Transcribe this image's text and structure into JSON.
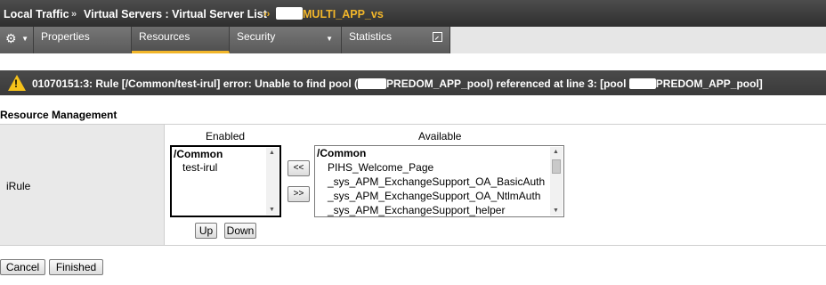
{
  "breadcrumb": {
    "items": [
      "Local Traffic",
      "Virtual Servers : Virtual Server List"
    ],
    "separator": "»",
    "current_separator": "››",
    "current": "MULTI_APP_vs"
  },
  "tabs": [
    {
      "label": "Properties"
    },
    {
      "label": "Resources"
    },
    {
      "label": "Security"
    },
    {
      "label": "Statistics"
    }
  ],
  "active_tab": "Resources",
  "error": {
    "text_part1": "01070151:3: Rule [/Common/test-irul] error: Unable to find pool (",
    "text_part2": "PREDOM_APP_pool) referenced at line 3: [pool",
    "text_part3": "PREDOM_APP_pool]"
  },
  "section_title": "Resource Management",
  "irule": {
    "label": "iRule",
    "enabled_heading": "Enabled",
    "available_heading": "Available",
    "enabled_group": "/Common",
    "enabled_items": [
      "test-irul"
    ],
    "available_group": "/Common",
    "available_items": [
      "PIHS_Welcome_Page",
      "_sys_APM_ExchangeSupport_OA_BasicAuth",
      "_sys_APM_ExchangeSupport_OA_NtlmAuth",
      "_sys_APM_ExchangeSupport_helper"
    ],
    "move_left_label": "<<",
    "move_right_label": ">>",
    "up_label": "Up",
    "down_label": "Down"
  },
  "footer": {
    "cancel_label": "Cancel",
    "finished_label": "Finished"
  },
  "colors": {
    "accent": "#f2b62a",
    "header_bg": "#3a3a3a",
    "warning": "#f6c21a"
  }
}
